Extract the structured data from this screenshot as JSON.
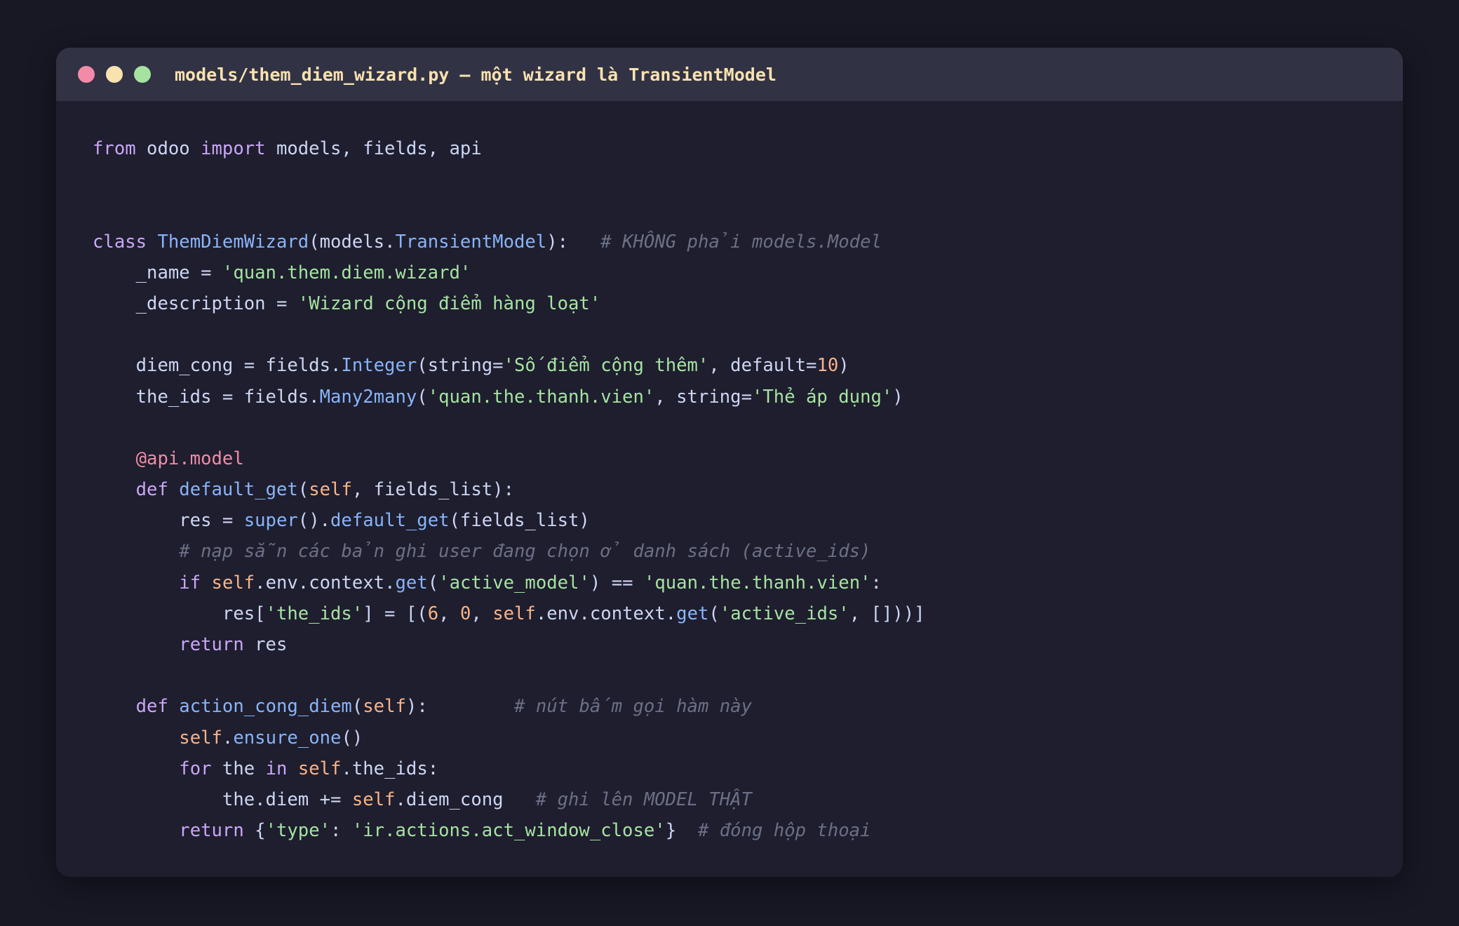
{
  "window": {
    "title": "models/them_diem_wizard.py — một wizard là TransientModel",
    "controls": [
      "close",
      "minimize",
      "maximize"
    ]
  },
  "colors": {
    "background": "#181825",
    "panel": "#1e1e2e",
    "titlebar": "#313244",
    "keyword": "#cba6f7",
    "function": "#89b4fa",
    "string": "#a6e3a1",
    "number": "#fab387",
    "decorator": "#f38ba8",
    "comment": "#6c7086",
    "text": "#cdd6f4"
  },
  "code": {
    "l1": {
      "t0": "from",
      "t1": " odoo ",
      "t2": "import",
      "t3": " models, fields, api"
    },
    "l4": {
      "t0": "class",
      "t1": " ",
      "t2": "ThemDiemWizard",
      "t3": "(models.",
      "t4": "TransientModel",
      "t5": "):   ",
      "t6": "# KHÔNG phải models.Model"
    },
    "l5": {
      "t0": "    _name = ",
      "t1": "'quan.them.diem.wizard'"
    },
    "l6": {
      "t0": "    _description = ",
      "t1": "'Wizard cộng điểm hàng loạt'"
    },
    "l8": {
      "t0": "    diem_cong = fields.",
      "t1": "Integer",
      "t2": "(string=",
      "t3": "'Số điểm cộng thêm'",
      "t4": ", default=",
      "t5": "10",
      "t6": ")"
    },
    "l9": {
      "t0": "    the_ids = fields.",
      "t1": "Many2many",
      "t2": "(",
      "t3": "'quan.the.thanh.vien'",
      "t4": ", string=",
      "t5": "'Thẻ áp dụng'",
      "t6": ")"
    },
    "l11": {
      "t0": "    ",
      "t1": "@api.model"
    },
    "l12": {
      "t0": "    ",
      "t1": "def",
      "t2": " ",
      "t3": "default_get",
      "t4": "(",
      "t5": "self",
      "t6": ", fields_list):"
    },
    "l13": {
      "t0": "        res = ",
      "t1": "super",
      "t2": "().",
      "t3": "default_get",
      "t4": "(fields_list)"
    },
    "l14": {
      "t0": "        ",
      "t1": "# nạp sẵn các bản ghi user đang chọn ở danh sách (active_ids)"
    },
    "l15": {
      "t0": "        ",
      "t1": "if",
      "t2": " ",
      "t3": "self",
      "t4": ".env.context.",
      "t5": "get",
      "t6": "(",
      "t7": "'active_model'",
      "t8": ") == ",
      "t9": "'quan.the.thanh.vien'",
      "t10": ":"
    },
    "l16": {
      "t0": "            res[",
      "t1": "'the_ids'",
      "t2": "] = [(",
      "t3": "6",
      "t4": ", ",
      "t5": "0",
      "t6": ", ",
      "t7": "self",
      "t8": ".env.context.",
      "t9": "get",
      "t10": "(",
      "t11": "'active_ids'",
      "t12": ", []))]"
    },
    "l17": {
      "t0": "        ",
      "t1": "return",
      "t2": " res"
    },
    "l19": {
      "t0": "    ",
      "t1": "def",
      "t2": " ",
      "t3": "action_cong_diem",
      "t4": "(",
      "t5": "self",
      "t6": "):        ",
      "t7": "# nút bấm gọi hàm này"
    },
    "l20": {
      "t0": "        ",
      "t1": "self",
      "t2": ".",
      "t3": "ensure_one",
      "t4": "()"
    },
    "l21": {
      "t0": "        ",
      "t1": "for",
      "t2": " the ",
      "t3": "in",
      "t4": " ",
      "t5": "self",
      "t6": ".the_ids:"
    },
    "l22": {
      "t0": "            the.diem += ",
      "t1": "self",
      "t2": ".diem_cong   ",
      "t3": "# ghi lên MODEL THẬT"
    },
    "l23": {
      "t0": "        ",
      "t1": "return",
      "t2": " {",
      "t3": "'type'",
      "t4": ": ",
      "t5": "'ir.actions.act_window_close'",
      "t6": "}  ",
      "t7": "# đóng hộp thoại"
    }
  }
}
